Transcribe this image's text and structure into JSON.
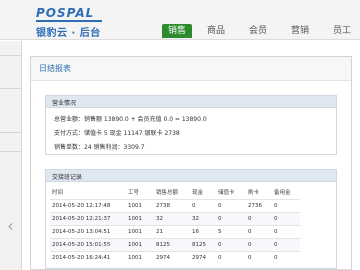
{
  "header": {
    "logo": "POSPAL",
    "brand": "银豹云 · 后台",
    "nav": [
      "销售",
      "商品",
      "会员",
      "营销",
      "员工"
    ],
    "active_nav": "销售",
    "accent_color": "#2d8a2d",
    "brand_color": "#2f6db5"
  },
  "main": {
    "title": "日结报表",
    "summary": {
      "heading": "营业情况",
      "line1": "总营业额：销售额 13890.0 + 会员充值 0.0 = 13890.0",
      "line2": "支付方式：储值卡 5   现金 11147   银联卡 2738",
      "line3": "销售单数：24   销售利润：3309.7"
    },
    "transactions": {
      "heading": "交接班记录",
      "columns": [
        "时间",
        "工号",
        "销售总额",
        "现金",
        "储值卡",
        "刷卡",
        "备用金"
      ],
      "rows": [
        [
          "2014-05-20 12:17:48",
          "1001",
          "2738",
          "0",
          "0",
          "2736",
          "0"
        ],
        [
          "2014-05-20 12:21:37",
          "1001",
          "32",
          "32",
          "0",
          "0",
          "0"
        ],
        [
          "2014-05-20 13:04:51",
          "1001",
          "21",
          "16",
          "5",
          "0",
          "0"
        ],
        [
          "2014-05-20 15:01:55",
          "1001",
          "8125",
          "8125",
          "0",
          "0",
          "0"
        ],
        [
          "2014-05-20 16:24:41",
          "1001",
          "2974",
          "2974",
          "0",
          "0",
          "0"
        ]
      ]
    }
  },
  "icons": {
    "sidebar_collapse": "chevron-left-icon"
  }
}
